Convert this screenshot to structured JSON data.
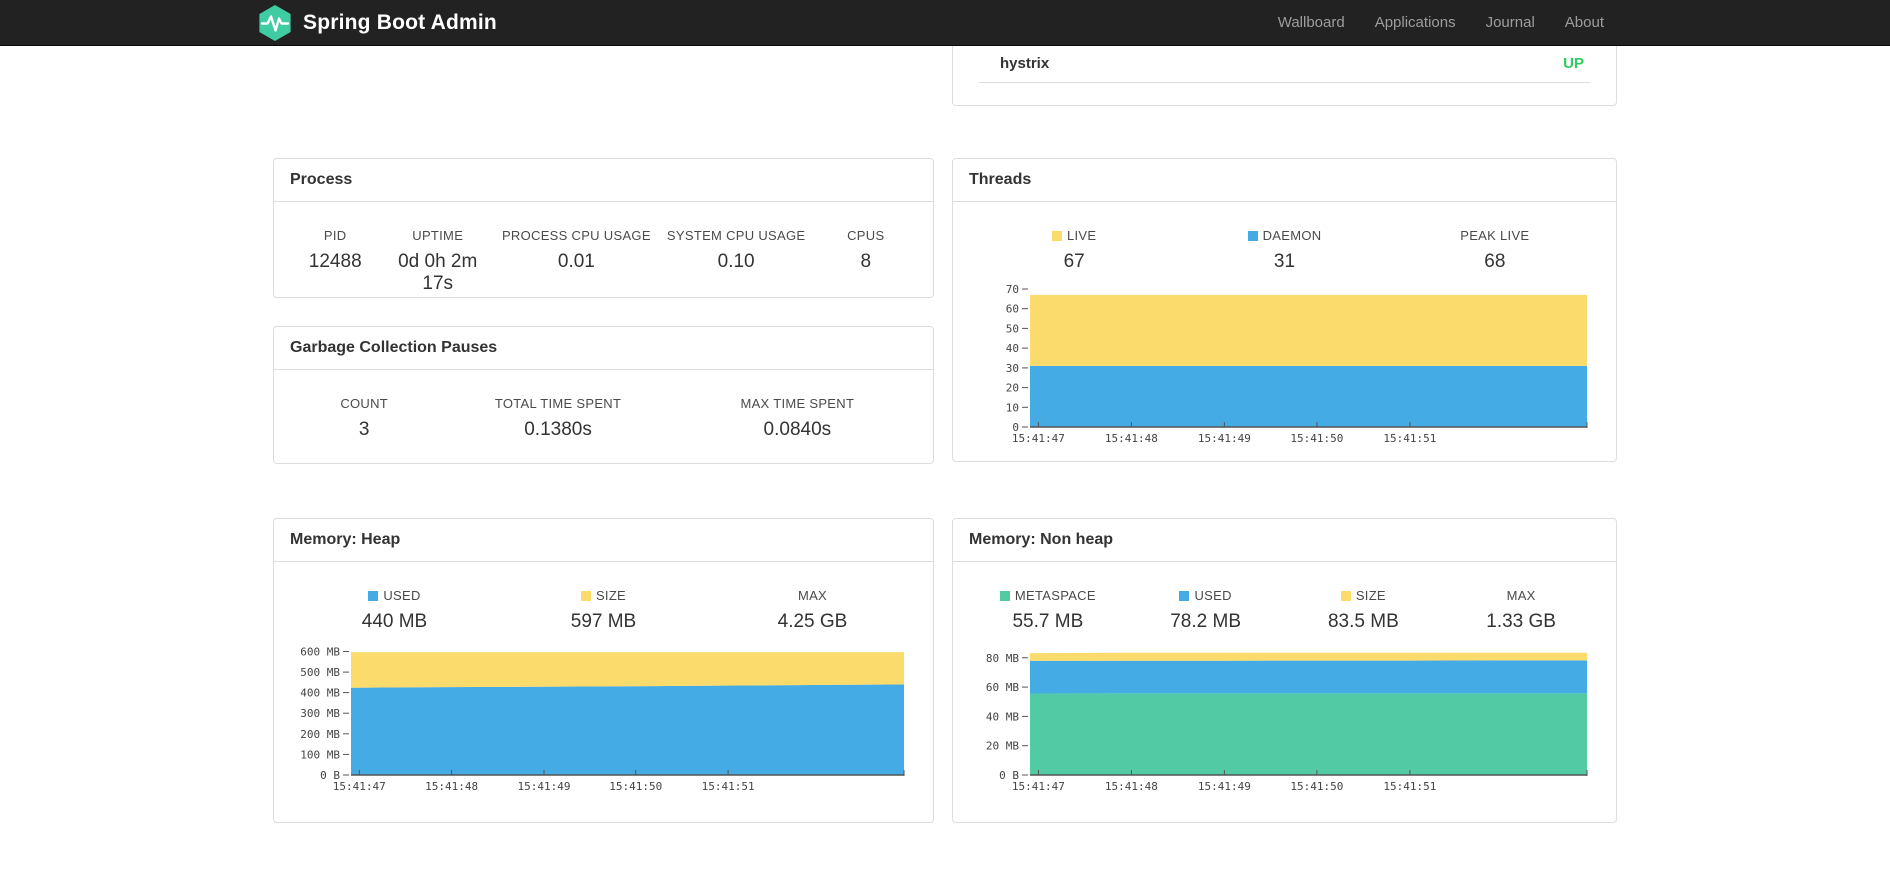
{
  "navbar": {
    "brand": "Spring Boot Admin",
    "brand_color": "#3FCCA3",
    "links": [
      {
        "label": "Wallboard"
      },
      {
        "label": "Applications"
      },
      {
        "label": "Journal"
      },
      {
        "label": "About"
      }
    ]
  },
  "status_panel": {
    "application": "hystrix",
    "status": "UP",
    "status_color": "#2ECD5F"
  },
  "process": {
    "title": "Process",
    "metrics": [
      {
        "label": "PID",
        "value": "12488"
      },
      {
        "label": "UPTIME",
        "value": "0d 0h 2m 17s"
      },
      {
        "label": "PROCESS CPU USAGE",
        "value": "0.01"
      },
      {
        "label": "SYSTEM CPU USAGE",
        "value": "0.10"
      },
      {
        "label": "CPUS",
        "value": "8"
      }
    ]
  },
  "gc": {
    "title": "Garbage Collection Pauses",
    "metrics": [
      {
        "label": "COUNT",
        "value": "3"
      },
      {
        "label": "TOTAL TIME SPENT",
        "value": "0.1380s"
      },
      {
        "label": "MAX TIME SPENT",
        "value": "0.0840s"
      }
    ]
  },
  "threads": {
    "title": "Threads",
    "metrics": [
      {
        "label": "LIVE",
        "value": "67",
        "swatch": "#FBDB6B"
      },
      {
        "label": "DAEMON",
        "value": "31",
        "swatch": "#45ABE5"
      },
      {
        "label": "PEAK LIVE",
        "value": "68",
        "swatch": ""
      }
    ]
  },
  "memory_heap": {
    "title": "Memory: Heap",
    "metrics": [
      {
        "label": "USED",
        "value": "440 MB",
        "swatch": "#45ABE5"
      },
      {
        "label": "SIZE",
        "value": "597 MB",
        "swatch": "#FBDB6B"
      },
      {
        "label": "MAX",
        "value": "4.25 GB",
        "swatch": ""
      }
    ]
  },
  "memory_nonheap": {
    "title": "Memory: Non heap",
    "metrics": [
      {
        "label": "METASPACE",
        "value": "55.7 MB",
        "swatch": "#52CBA5"
      },
      {
        "label": "USED",
        "value": "78.2 MB",
        "swatch": "#45ABE5"
      },
      {
        "label": "SIZE",
        "value": "83.5 MB",
        "swatch": "#FBDB6B"
      },
      {
        "label": "MAX",
        "value": "1.33 GB",
        "swatch": ""
      }
    ]
  },
  "chart_data": [
    {
      "id": "threads",
      "type": "area",
      "stacked": true,
      "title": "Threads",
      "legend": [
        "LIVE",
        "DAEMON"
      ],
      "legend_position": "top",
      "grid": false,
      "ylim": [
        0,
        70
      ],
      "yticks": [
        {
          "value": 0,
          "label": "0"
        },
        {
          "value": 10,
          "label": "10"
        },
        {
          "value": 20,
          "label": "20"
        },
        {
          "value": 30,
          "label": "30"
        },
        {
          "value": 40,
          "label": "40"
        },
        {
          "value": 50,
          "label": "50"
        },
        {
          "value": 60,
          "label": "60"
        },
        {
          "value": 70,
          "label": "70"
        }
      ],
      "xticks": [
        "15:41:47",
        "15:41:48",
        "15:41:49",
        "15:41:50",
        "15:41:51"
      ],
      "xtick_fracs": [
        0.015,
        0.182,
        0.349,
        0.515,
        0.682
      ],
      "series": [
        {
          "name": "DAEMON",
          "color": "#45ABE5",
          "values": [
            31,
            31,
            31,
            31,
            31,
            31,
            31
          ]
        },
        {
          "name": "LIVE",
          "color": "#FBDB6B",
          "values": [
            67,
            67,
            67,
            67,
            67,
            67,
            67
          ]
        }
      ]
    },
    {
      "id": "memory-heap",
      "type": "area",
      "stacked": true,
      "title": "Memory: Heap",
      "legend": [
        "USED",
        "SIZE"
      ],
      "legend_position": "top",
      "grid": false,
      "ylim": [
        0,
        612
      ],
      "yticks": [
        {
          "value": 0,
          "label": "0 B"
        },
        {
          "value": 100,
          "label": "100 MB"
        },
        {
          "value": 200,
          "label": "200 MB"
        },
        {
          "value": 300,
          "label": "300 MB"
        },
        {
          "value": 400,
          "label": "400 MB"
        },
        {
          "value": 500,
          "label": "500 MB"
        },
        {
          "value": 600,
          "label": "600 MB"
        }
      ],
      "xticks": [
        "15:41:47",
        "15:41:48",
        "15:41:49",
        "15:41:50",
        "15:41:51"
      ],
      "xtick_fracs": [
        0.015,
        0.182,
        0.349,
        0.515,
        0.682
      ],
      "series": [
        {
          "name": "USED",
          "color": "#45ABE5",
          "values": [
            424,
            427,
            429,
            431,
            434,
            437,
            440
          ]
        },
        {
          "name": "SIZE",
          "color": "#FBDB6B",
          "values": [
            597,
            597,
            597,
            597,
            597,
            597,
            597
          ]
        }
      ]
    },
    {
      "id": "memory-nonheap",
      "type": "area",
      "stacked": true,
      "title": "Memory: Non heap",
      "legend": [
        "METASPACE",
        "USED",
        "SIZE"
      ],
      "legend_position": "top",
      "grid": false,
      "ylim": [
        0,
        86
      ],
      "yticks": [
        {
          "value": 0,
          "label": "0 B"
        },
        {
          "value": 20,
          "label": "20 MB"
        },
        {
          "value": 40,
          "label": "40 MB"
        },
        {
          "value": 60,
          "label": "60 MB"
        },
        {
          "value": 80,
          "label": "80 MB"
        }
      ],
      "xticks": [
        "15:41:47",
        "15:41:48",
        "15:41:49",
        "15:41:50",
        "15:41:51"
      ],
      "xtick_fracs": [
        0.015,
        0.182,
        0.349,
        0.515,
        0.682
      ],
      "series": [
        {
          "name": "METASPACE",
          "color": "#52CBA5",
          "values": [
            55.6,
            55.7,
            55.7,
            55.7,
            55.7,
            55.7,
            55.7
          ]
        },
        {
          "name": "USED",
          "color": "#45ABE5",
          "values": [
            77.9,
            78.0,
            78.0,
            78.1,
            78.1,
            78.2,
            78.2
          ]
        },
        {
          "name": "SIZE",
          "color": "#FBDB6B",
          "values": [
            83.2,
            83.4,
            83.4,
            83.5,
            83.5,
            83.5,
            83.5
          ]
        }
      ]
    }
  ]
}
